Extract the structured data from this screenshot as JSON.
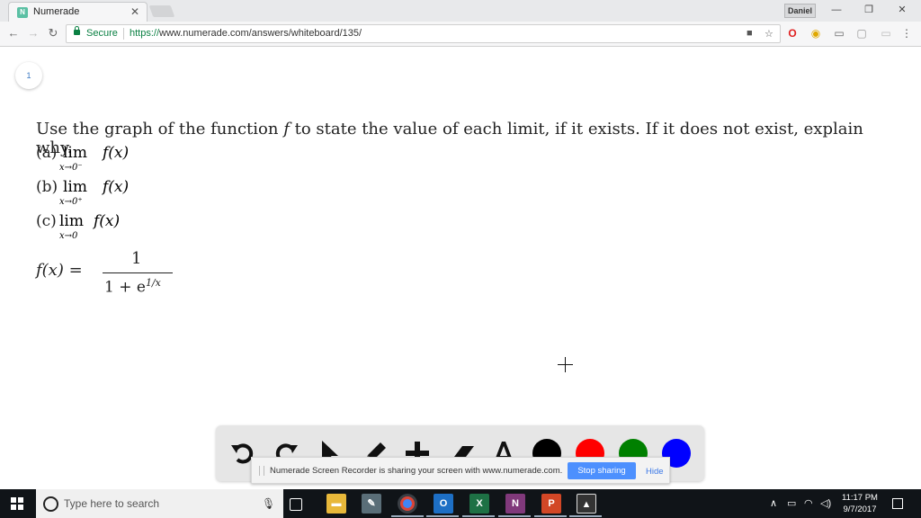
{
  "browser": {
    "tab_title": "Numerade",
    "tab_close": "✕",
    "favicon": "N",
    "profile": "Daniel",
    "secure_label": "Secure",
    "url_protocol": "https://",
    "url_rest": "www.numerade.com/answers/whiteboard/135/"
  },
  "page": {
    "page_number": "1",
    "question_text": "Use the graph of the function",
    "question_var": "f",
    "question_rest": "to state the value of each limit, if it exists. If it does not exist, explain why.",
    "parts": [
      {
        "label": "(a)",
        "lim": "lim",
        "sub": "x→0⁻",
        "expr": "f(x)"
      },
      {
        "label": "(b)",
        "lim": "lim",
        "sub": "x→0⁺",
        "expr": "f(x)"
      },
      {
        "label": "(c)",
        "lim": "lim",
        "sub": "x→0",
        "expr": "f(x)"
      }
    ],
    "formula": {
      "lhs": "f(x) =",
      "numerator": "1",
      "denominator": "1 + e",
      "exponent": "1/x"
    }
  },
  "palette": {
    "tools": [
      "undo-icon",
      "redo-icon",
      "pointer-icon",
      "pen-icon",
      "add-icon",
      "eraser-icon",
      "text-icon"
    ],
    "colors": [
      "#000000",
      "#ff0000",
      "#008000",
      "#0000ff"
    ]
  },
  "sharebar": {
    "message": "Numerade Screen Recorder is sharing your screen with www.numerade.com.",
    "stop_label": "Stop sharing",
    "hide_label": "Hide"
  },
  "taskbar": {
    "search_placeholder": "Type here to search",
    "time": "11:17 PM",
    "date": "9/7/2017"
  }
}
